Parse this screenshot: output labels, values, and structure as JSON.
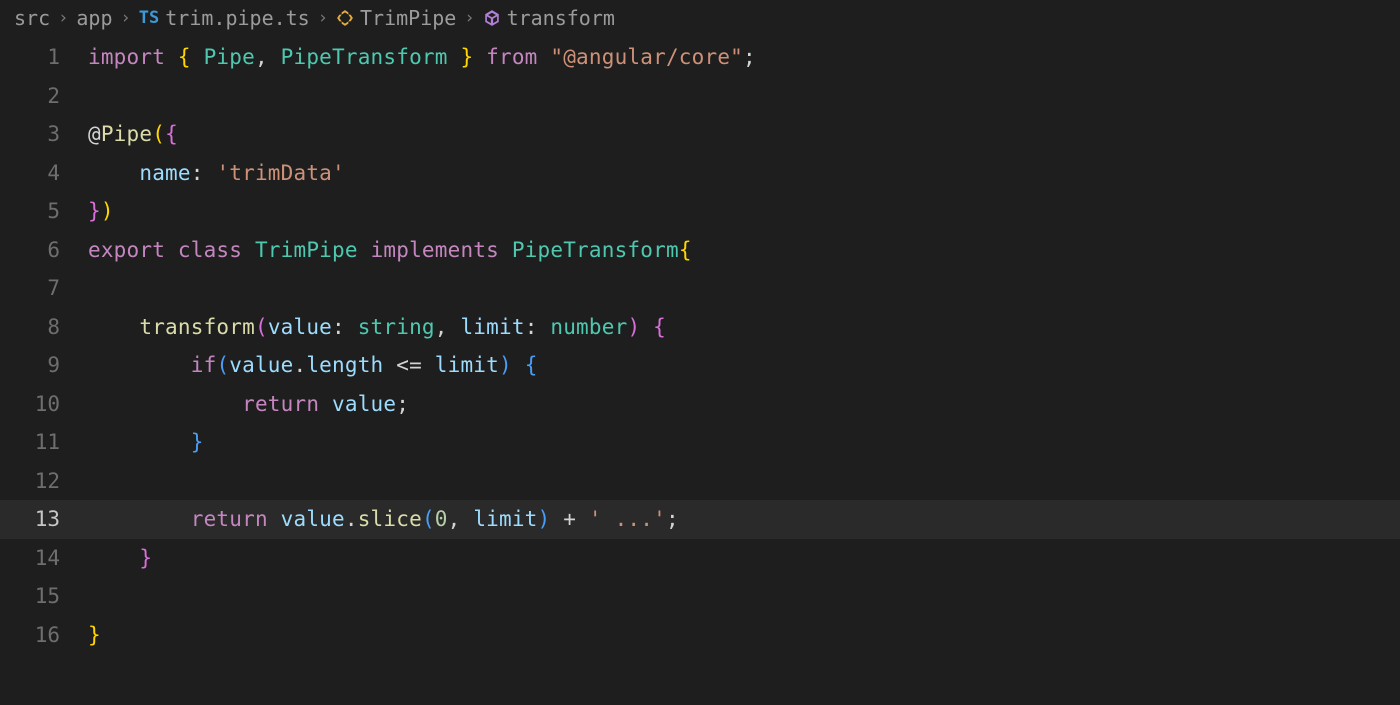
{
  "breadcrumb": {
    "items": [
      {
        "label": "src",
        "icon": null
      },
      {
        "label": "app",
        "icon": null
      },
      {
        "label": "trim.pipe.ts",
        "icon": "ts"
      },
      {
        "label": "TrimPipe",
        "icon": "class"
      },
      {
        "label": "transform",
        "icon": "method"
      }
    ],
    "sep": "›"
  },
  "editor": {
    "highlighted_line": 13,
    "lines": [
      {
        "n": 1,
        "tokens": [
          [
            "keyword",
            "import"
          ],
          [
            "punc",
            " "
          ],
          [
            "brace",
            "{"
          ],
          [
            "punc",
            " "
          ],
          [
            "type",
            "Pipe"
          ],
          [
            "punc",
            ", "
          ],
          [
            "type",
            "PipeTransform"
          ],
          [
            "punc",
            " "
          ],
          [
            "brace",
            "}"
          ],
          [
            "punc",
            " "
          ],
          [
            "keyword",
            "from"
          ],
          [
            "punc",
            " "
          ],
          [
            "string",
            "\"@angular/core\""
          ],
          [
            "punc",
            ";"
          ]
        ]
      },
      {
        "n": 2,
        "tokens": []
      },
      {
        "n": 3,
        "tokens": [
          [
            "punc",
            "@"
          ],
          [
            "func",
            "Pipe"
          ],
          [
            "brace",
            "("
          ],
          [
            "brace2",
            "{"
          ]
        ]
      },
      {
        "n": 4,
        "tokens": [
          [
            "indent",
            "    "
          ],
          [
            "param",
            "name"
          ],
          [
            "punc",
            ":"
          ],
          [
            "punc",
            " "
          ],
          [
            "string",
            "'trimData'"
          ]
        ]
      },
      {
        "n": 5,
        "tokens": [
          [
            "brace2",
            "}"
          ],
          [
            "brace",
            ")"
          ]
        ]
      },
      {
        "n": 6,
        "tokens": [
          [
            "keyword",
            "export"
          ],
          [
            "punc",
            " "
          ],
          [
            "keyword",
            "class"
          ],
          [
            "punc",
            " "
          ],
          [
            "type",
            "TrimPipe"
          ],
          [
            "punc",
            " "
          ],
          [
            "keyword",
            "implements"
          ],
          [
            "punc",
            " "
          ],
          [
            "type",
            "PipeTransform"
          ],
          [
            "brace",
            "{"
          ]
        ]
      },
      {
        "n": 7,
        "tokens": []
      },
      {
        "n": 8,
        "tokens": [
          [
            "indent",
            "    "
          ],
          [
            "func",
            "transform"
          ],
          [
            "brace2",
            "("
          ],
          [
            "param",
            "value"
          ],
          [
            "punc",
            ":"
          ],
          [
            "punc",
            " "
          ],
          [
            "primtype",
            "string"
          ],
          [
            "punc",
            ", "
          ],
          [
            "param",
            "limit"
          ],
          [
            "punc",
            ":"
          ],
          [
            "punc",
            " "
          ],
          [
            "primtype",
            "number"
          ],
          [
            "brace2",
            ")"
          ],
          [
            "punc",
            " "
          ],
          [
            "brace2",
            "{"
          ]
        ]
      },
      {
        "n": 9,
        "tokens": [
          [
            "indent",
            "        "
          ],
          [
            "keyword",
            "if"
          ],
          [
            "brace3",
            "("
          ],
          [
            "param",
            "value"
          ],
          [
            "punc",
            "."
          ],
          [
            "param",
            "length"
          ],
          [
            "punc",
            " "
          ],
          [
            "op",
            "<="
          ],
          [
            "punc",
            " "
          ],
          [
            "param",
            "limit"
          ],
          [
            "brace3",
            ")"
          ],
          [
            "punc",
            " "
          ],
          [
            "brace3",
            "{"
          ]
        ]
      },
      {
        "n": 10,
        "tokens": [
          [
            "indent",
            "            "
          ],
          [
            "keyword",
            "return"
          ],
          [
            "punc",
            " "
          ],
          [
            "param",
            "value"
          ],
          [
            "punc",
            ";"
          ]
        ]
      },
      {
        "n": 11,
        "tokens": [
          [
            "indent",
            "        "
          ],
          [
            "brace3",
            "}"
          ]
        ]
      },
      {
        "n": 12,
        "tokens": []
      },
      {
        "n": 13,
        "tokens": [
          [
            "indent",
            "        "
          ],
          [
            "keyword",
            "return"
          ],
          [
            "punc",
            " "
          ],
          [
            "param",
            "value"
          ],
          [
            "punc",
            "."
          ],
          [
            "func",
            "slice"
          ],
          [
            "brace3",
            "("
          ],
          [
            "number",
            "0"
          ],
          [
            "punc",
            ", "
          ],
          [
            "param",
            "limit"
          ],
          [
            "brace3",
            ")"
          ],
          [
            "punc",
            " "
          ],
          [
            "op",
            "+"
          ],
          [
            "punc",
            " "
          ],
          [
            "string",
            "' ...'"
          ],
          [
            "punc",
            ";"
          ]
        ]
      },
      {
        "n": 14,
        "tokens": [
          [
            "indent",
            "    "
          ],
          [
            "brace2",
            "}"
          ]
        ]
      },
      {
        "n": 15,
        "tokens": []
      },
      {
        "n": 16,
        "tokens": [
          [
            "brace",
            "}"
          ]
        ]
      }
    ]
  },
  "colors": {
    "background": "#1e1e1e",
    "line_highlight": "#2a2a2a",
    "keyword": "#c586c0",
    "type": "#4ec9b0",
    "string": "#ce9178",
    "function": "#dcdcaa",
    "variable": "#9cdcfe",
    "number": "#b5cea8"
  }
}
